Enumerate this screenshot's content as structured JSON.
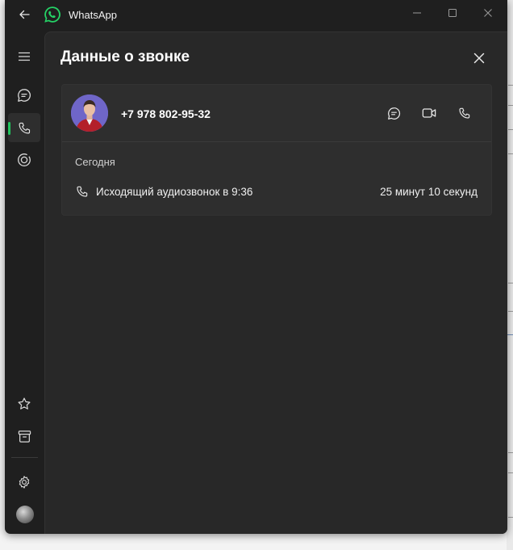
{
  "window": {
    "app_title": "WhatsApp"
  },
  "sidebar": {
    "items": [
      {
        "name": "menu",
        "icon": "hamburger-menu-icon"
      },
      {
        "name": "chats",
        "icon": "chat-bubble-icon"
      },
      {
        "name": "calls",
        "icon": "phone-icon",
        "active": true
      },
      {
        "name": "status",
        "icon": "status-ring-icon"
      },
      {
        "name": "starred",
        "icon": "star-icon"
      },
      {
        "name": "archived",
        "icon": "archive-icon"
      },
      {
        "name": "settings",
        "icon": "gear-icon"
      },
      {
        "name": "profile",
        "icon": "avatar"
      }
    ]
  },
  "panel": {
    "title": "Данные о звонке"
  },
  "contact": {
    "phone": "+7 978 802-95-32"
  },
  "call_log": {
    "date": "Сегодня",
    "entries": [
      {
        "description": "Исходящий аудиозвонок в 9:36",
        "duration": "25 минут 10 секунд"
      }
    ]
  },
  "colors": {
    "accent": "#22c55e",
    "window_bg": "#1f1f1f",
    "panel_bg": "#282828",
    "card_bg": "#2e2e2e",
    "avatar_bg": "#6f66c8"
  }
}
